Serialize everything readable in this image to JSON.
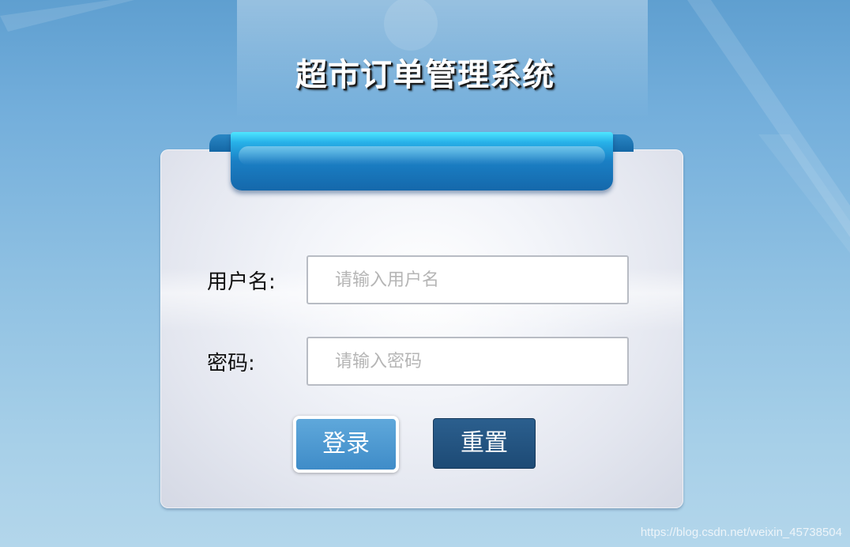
{
  "app": {
    "title": "超市订单管理系统"
  },
  "login_form": {
    "username_label": "用户名:",
    "username_placeholder": "请输入用户名",
    "username_value": "",
    "password_label": "密码:",
    "password_placeholder": "请输入密码",
    "password_value": "",
    "login_label": "登录",
    "reset_label": "重置"
  },
  "watermark": {
    "text": "https://blog.csdn.net/weixin_45738504"
  },
  "colors": {
    "ribbon": "#1a7fc4",
    "login_button": "#4a96d0",
    "reset_button": "#234f7b"
  }
}
